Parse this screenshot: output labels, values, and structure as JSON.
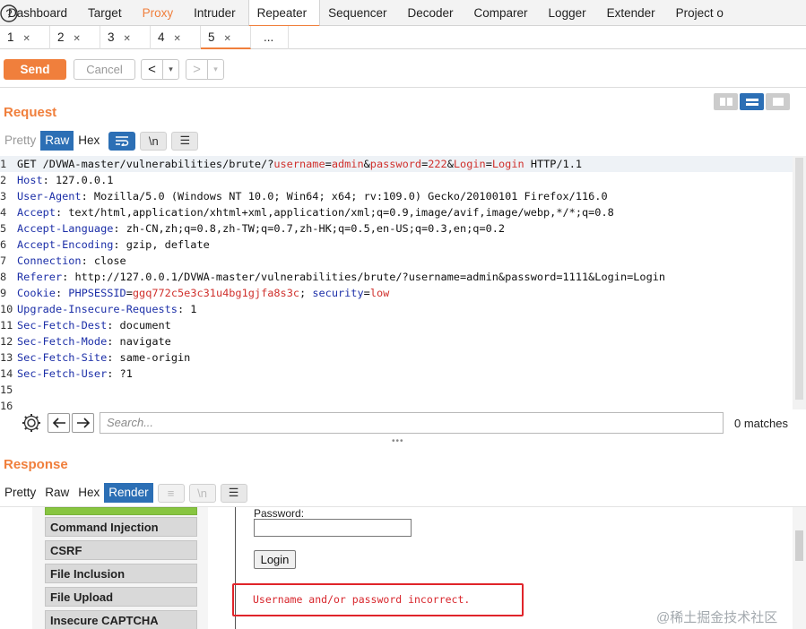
{
  "top_tabs": [
    "Dashboard",
    "Target",
    "Proxy",
    "Intruder",
    "Repeater",
    "Sequencer",
    "Decoder",
    "Comparer",
    "Logger",
    "Extender",
    "Project o"
  ],
  "sub_tabs": [
    "1",
    "2",
    "3",
    "4",
    "5",
    "..."
  ],
  "toolbar": {
    "send_label": "Send",
    "cancel_label": "Cancel",
    "back_glyph": "<",
    "forward_glyph": ">",
    "dropdown_glyph": "▾"
  },
  "request": {
    "title": "Request",
    "view_tabs": [
      "Pretty",
      "Raw",
      "Hex"
    ],
    "wrap_label": "\\n",
    "lines": [
      {
        "n": "1",
        "parts": [
          [
            "v",
            "GET /DVWA-master/vulnerabilities/brute/?"
          ],
          [
            "p",
            "username"
          ],
          [
            "v",
            "="
          ],
          [
            "p",
            "admin"
          ],
          [
            "v",
            "&"
          ],
          [
            "p",
            "password"
          ],
          [
            "v",
            "="
          ],
          [
            "p",
            "222"
          ],
          [
            "v",
            "&"
          ],
          [
            "p",
            "Login"
          ],
          [
            "v",
            "="
          ],
          [
            "p",
            "Login"
          ],
          [
            "v",
            " HTTP/1.1"
          ]
        ]
      },
      {
        "n": "2",
        "parts": [
          [
            "k",
            "Host"
          ],
          [
            "v",
            ": 127.0.0.1"
          ]
        ]
      },
      {
        "n": "3",
        "parts": [
          [
            "k",
            "User-Agent"
          ],
          [
            "v",
            ": Mozilla/5.0 (Windows NT 10.0; Win64; x64; rv:109.0) Gecko/20100101 Firefox/116.0"
          ]
        ]
      },
      {
        "n": "4",
        "parts": [
          [
            "k",
            "Accept"
          ],
          [
            "v",
            ": text/html,application/xhtml+xml,application/xml;q=0.9,image/avif,image/webp,*/*;q=0.8"
          ]
        ]
      },
      {
        "n": "5",
        "parts": [
          [
            "k",
            "Accept-Language"
          ],
          [
            "v",
            ": zh-CN,zh;q=0.8,zh-TW;q=0.7,zh-HK;q=0.5,en-US;q=0.3,en;q=0.2"
          ]
        ]
      },
      {
        "n": "6",
        "parts": [
          [
            "k",
            "Accept-Encoding"
          ],
          [
            "v",
            ": gzip, deflate"
          ]
        ]
      },
      {
        "n": "7",
        "parts": [
          [
            "k",
            "Connection"
          ],
          [
            "v",
            ": close"
          ]
        ]
      },
      {
        "n": "8",
        "parts": [
          [
            "k",
            "Referer"
          ],
          [
            "v",
            ": http://127.0.0.1/DVWA-master/vulnerabilities/brute/?username=admin&password=1111&Login=Login"
          ]
        ]
      },
      {
        "n": "9",
        "parts": [
          [
            "k",
            "Cookie"
          ],
          [
            "v",
            ": "
          ],
          [
            "k",
            "PHPSESSID"
          ],
          [
            "v",
            "="
          ],
          [
            "p",
            "ggq772c5e3c31u4bg1gjfa8s3c"
          ],
          [
            "v",
            "; "
          ],
          [
            "k",
            "security"
          ],
          [
            "v",
            "="
          ],
          [
            "p",
            "low"
          ]
        ]
      },
      {
        "n": "10",
        "parts": [
          [
            "k",
            "Upgrade-Insecure-Requests"
          ],
          [
            "v",
            ": 1"
          ]
        ]
      },
      {
        "n": "11",
        "parts": [
          [
            "k",
            "Sec-Fetch-Dest"
          ],
          [
            "v",
            ": document"
          ]
        ]
      },
      {
        "n": "12",
        "parts": [
          [
            "k",
            "Sec-Fetch-Mode"
          ],
          [
            "v",
            ": navigate"
          ]
        ]
      },
      {
        "n": "13",
        "parts": [
          [
            "k",
            "Sec-Fetch-Site"
          ],
          [
            "v",
            ": same-origin"
          ]
        ]
      },
      {
        "n": "14",
        "parts": [
          [
            "k",
            "Sec-Fetch-User"
          ],
          [
            "v",
            ": ?1"
          ]
        ]
      },
      {
        "n": "15",
        "parts": []
      },
      {
        "n": "16",
        "parts": []
      }
    ]
  },
  "search": {
    "placeholder": "Search...",
    "matches": "0 matches"
  },
  "response": {
    "title": "Response",
    "view_tabs": [
      "Pretty",
      "Raw",
      "Hex",
      "Render"
    ],
    "menu_items": [
      "Command Injection",
      "CSRF",
      "File Inclusion",
      "File Upload",
      "Insecure CAPTCHA"
    ],
    "password_label": "Password:",
    "login_button": "Login",
    "error_message": "Username and/or password incorrect."
  },
  "watermark": "@稀土掘金技术社区",
  "colors": {
    "accent": "#f07f3c",
    "selected": "#2c6fb5",
    "error": "#d8262c"
  }
}
